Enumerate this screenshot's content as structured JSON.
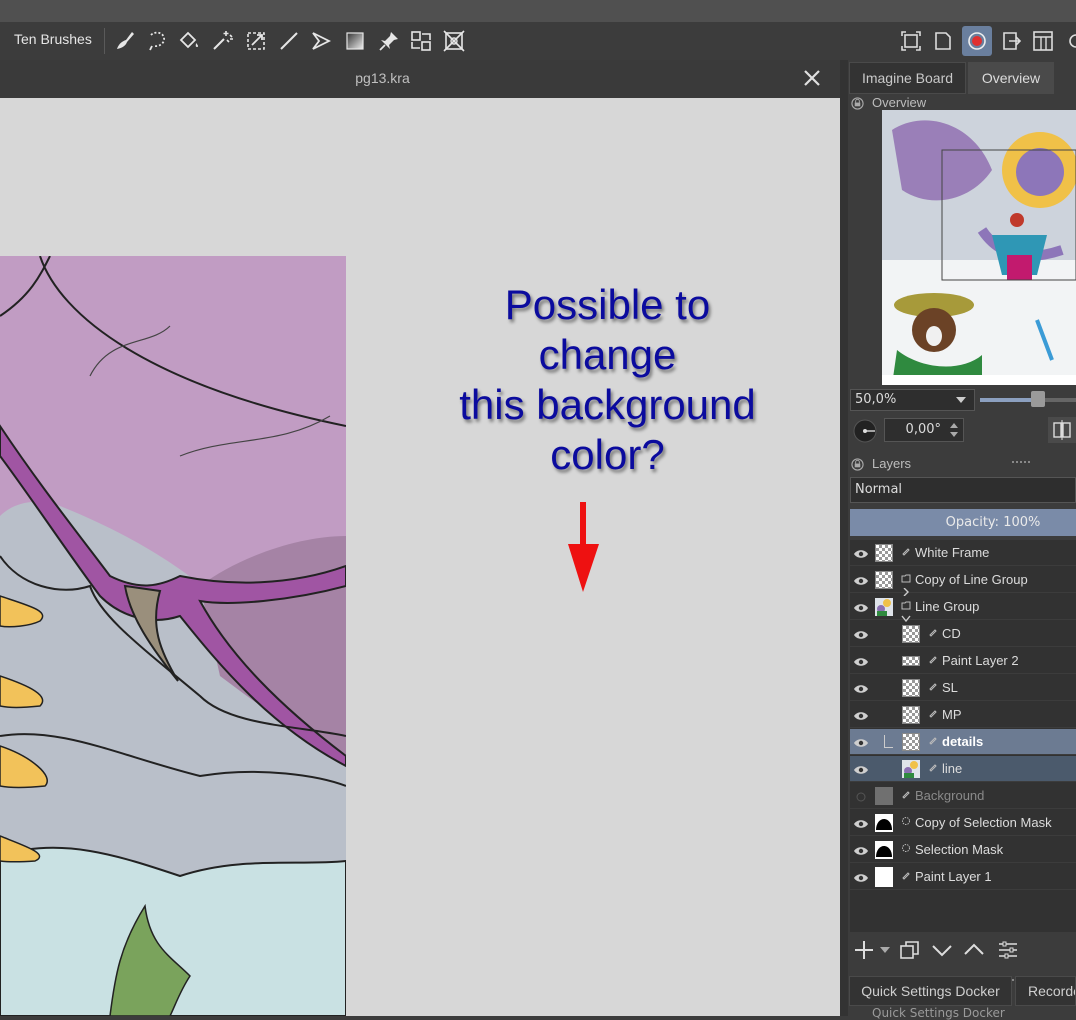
{
  "toolbar": {
    "preset_label": "Ten Brushes",
    "tools": [
      {
        "name": "freehand-brush-icon"
      },
      {
        "name": "freehand-selection-icon"
      },
      {
        "name": "fill-icon"
      },
      {
        "name": "magic-wand-icon"
      },
      {
        "name": "transform-icon"
      },
      {
        "name": "line-icon"
      },
      {
        "name": "polyline-icon"
      },
      {
        "name": "gradient-icon"
      },
      {
        "name": "assistant-pin-icon"
      },
      {
        "name": "reference-icon"
      },
      {
        "name": "perspective-icon"
      }
    ],
    "right_icons": [
      "fit-frame-icon",
      "canvas-only-icon",
      "record-icon",
      "export-icon",
      "workspace-icon"
    ]
  },
  "document": {
    "title": "pg13.kra",
    "close_symbol": "✕",
    "canvas_color": "#d7d7d7"
  },
  "annotation": {
    "lines": [
      "Possible to",
      "change",
      "this background",
      "color?"
    ],
    "color": "#0b0b9e",
    "arrow_color": "#ee1111"
  },
  "dock_tabs": {
    "tab1": "Imagine Board",
    "tab2": "Overview"
  },
  "overview": {
    "title": "Overview",
    "zoom": "50,0%",
    "rotation": "0,00°"
  },
  "layers": {
    "title": "Layers",
    "blend_mode": "Normal",
    "opacity_label": "Opacity:  100%",
    "items": [
      {
        "name": "White Frame",
        "indent": 0,
        "thumb": "checker",
        "state": "normal",
        "type": "paint"
      },
      {
        "name": "Copy of Line Group",
        "indent": 0,
        "thumb": "checker",
        "state": "normal",
        "type": "group"
      },
      {
        "name": "Line Group",
        "indent": 0,
        "thumb": "art",
        "state": "normal",
        "type": "group"
      },
      {
        "name": "CD",
        "indent": 1,
        "thumb": "checker",
        "state": "normal",
        "type": "paint"
      },
      {
        "name": "Paint Layer 2",
        "indent": 1,
        "thumb": "strip",
        "state": "normal",
        "type": "paint"
      },
      {
        "name": "SL",
        "indent": 1,
        "thumb": "checker",
        "state": "normal",
        "type": "paint"
      },
      {
        "name": "MP",
        "indent": 1,
        "thumb": "checker",
        "state": "normal",
        "type": "paint"
      },
      {
        "name": "details",
        "indent": 1,
        "thumb": "checker",
        "state": "selected",
        "type": "paint"
      },
      {
        "name": "line",
        "indent": 1,
        "thumb": "art",
        "state": "active",
        "type": "paint"
      },
      {
        "name": "Background",
        "indent": 0,
        "thumb": "grey",
        "state": "hidden",
        "type": "paint"
      },
      {
        "name": "Copy of Selection Mask",
        "indent": 0,
        "thumb": "mask",
        "state": "normal",
        "type": "mask"
      },
      {
        "name": "Selection Mask",
        "indent": 0,
        "thumb": "mask",
        "state": "normal",
        "type": "mask"
      },
      {
        "name": "Paint Layer 1",
        "indent": 0,
        "thumb": "white",
        "state": "normal",
        "type": "paint"
      }
    ]
  },
  "bottom_tabs": {
    "tab1": "Quick Settings Docker",
    "tab2": "Recorde",
    "panel_title": "Quick Settings Docker"
  }
}
